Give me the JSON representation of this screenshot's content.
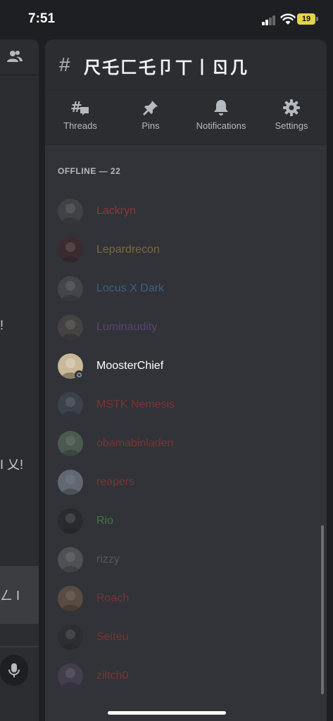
{
  "status_bar": {
    "time": "7:51",
    "battery": "19"
  },
  "left_pane": {
    "fragments": [
      "!",
      "I 乂!",
      "ㄥ I"
    ]
  },
  "channel": {
    "hash": "#",
    "name": "尺乇匚乇卩丅丨ㄖ几"
  },
  "toolbar": {
    "threads": "Threads",
    "pins": "Pins",
    "notifications": "Notifications",
    "settings": "Settings"
  },
  "members_section": {
    "title": "OFFLINE — 22",
    "members": [
      {
        "name": "Lackryn",
        "color": "#8a3b3b",
        "avatar_bg": "#555555",
        "dim": true
      },
      {
        "name": "Lepardrecon",
        "color": "#7a6b3a",
        "avatar_bg": "#4a2222",
        "dim": true
      },
      {
        "name": "Locus X Dark",
        "color": "#3f5e83",
        "avatar_bg": "#5a5a66",
        "dim": true
      },
      {
        "name": "Luminaudity",
        "color": "#5b4470",
        "avatar_bg": "#5e5550",
        "dim": true
      },
      {
        "name": "MoosterChief",
        "color": "#ffffff",
        "avatar_bg": "#c9b89a",
        "dim": false
      },
      {
        "name": "MSTK Nemesis",
        "color": "#7a3434",
        "avatar_bg": "#4a5566",
        "dim": true
      },
      {
        "name": "obamabinladen",
        "color": "#7a3434",
        "avatar_bg": "#6b8a6b",
        "dim": true
      },
      {
        "name": "reapers",
        "color": "#7a3434",
        "avatar_bg": "#9aaabb",
        "dim": true
      },
      {
        "name": "Rio",
        "color": "#3f7a3a",
        "avatar_bg": "#222222",
        "dim": true
      },
      {
        "name": "rizzy",
        "color": "#55575c",
        "avatar_bg": "#777777",
        "dim": true
      },
      {
        "name": "Roach",
        "color": "#7a3434",
        "avatar_bg": "#8a6a4a",
        "dim": true
      },
      {
        "name": "Seiteu",
        "color": "#7a3434",
        "avatar_bg": "#2a2a2a",
        "dim": true
      },
      {
        "name": "ziltch0",
        "color": "#7a3434",
        "avatar_bg": "#5a4a6a",
        "dim": true
      }
    ]
  },
  "colors": {
    "background": "#1e1f22",
    "drawer": "#313338",
    "header": "#2b2d31"
  }
}
